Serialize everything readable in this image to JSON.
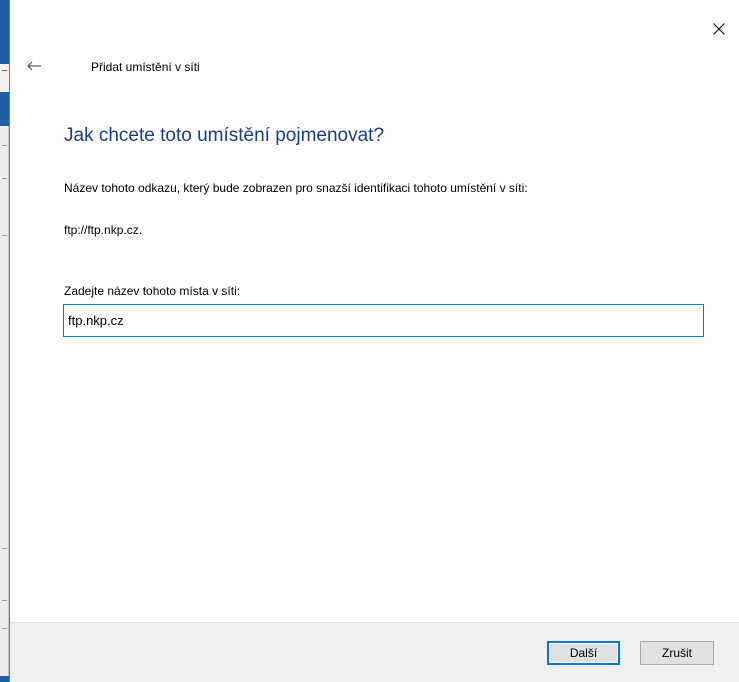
{
  "dialog": {
    "title": "Přidat umístění v síti",
    "heading": "Jak chcete toto umístění pojmenovat?",
    "description": "Název tohoto odkazu, který bude zobrazen pro snazší identifikaci tohoto umístění v síti:",
    "address": "ftp://ftp.nkp.cz.",
    "name_label": "Zadejte název tohoto místa v síti:",
    "name_value": "ftp.nkp.cz"
  },
  "buttons": {
    "next_label": "Další",
    "cancel_label": "Zrušit"
  },
  "icons": {
    "close": "close-icon",
    "back": "back-arrow-icon"
  },
  "colors": {
    "heading": "#1a3d8f",
    "focus_border": "#0078d7",
    "footer_bg": "#f0f0f0"
  }
}
